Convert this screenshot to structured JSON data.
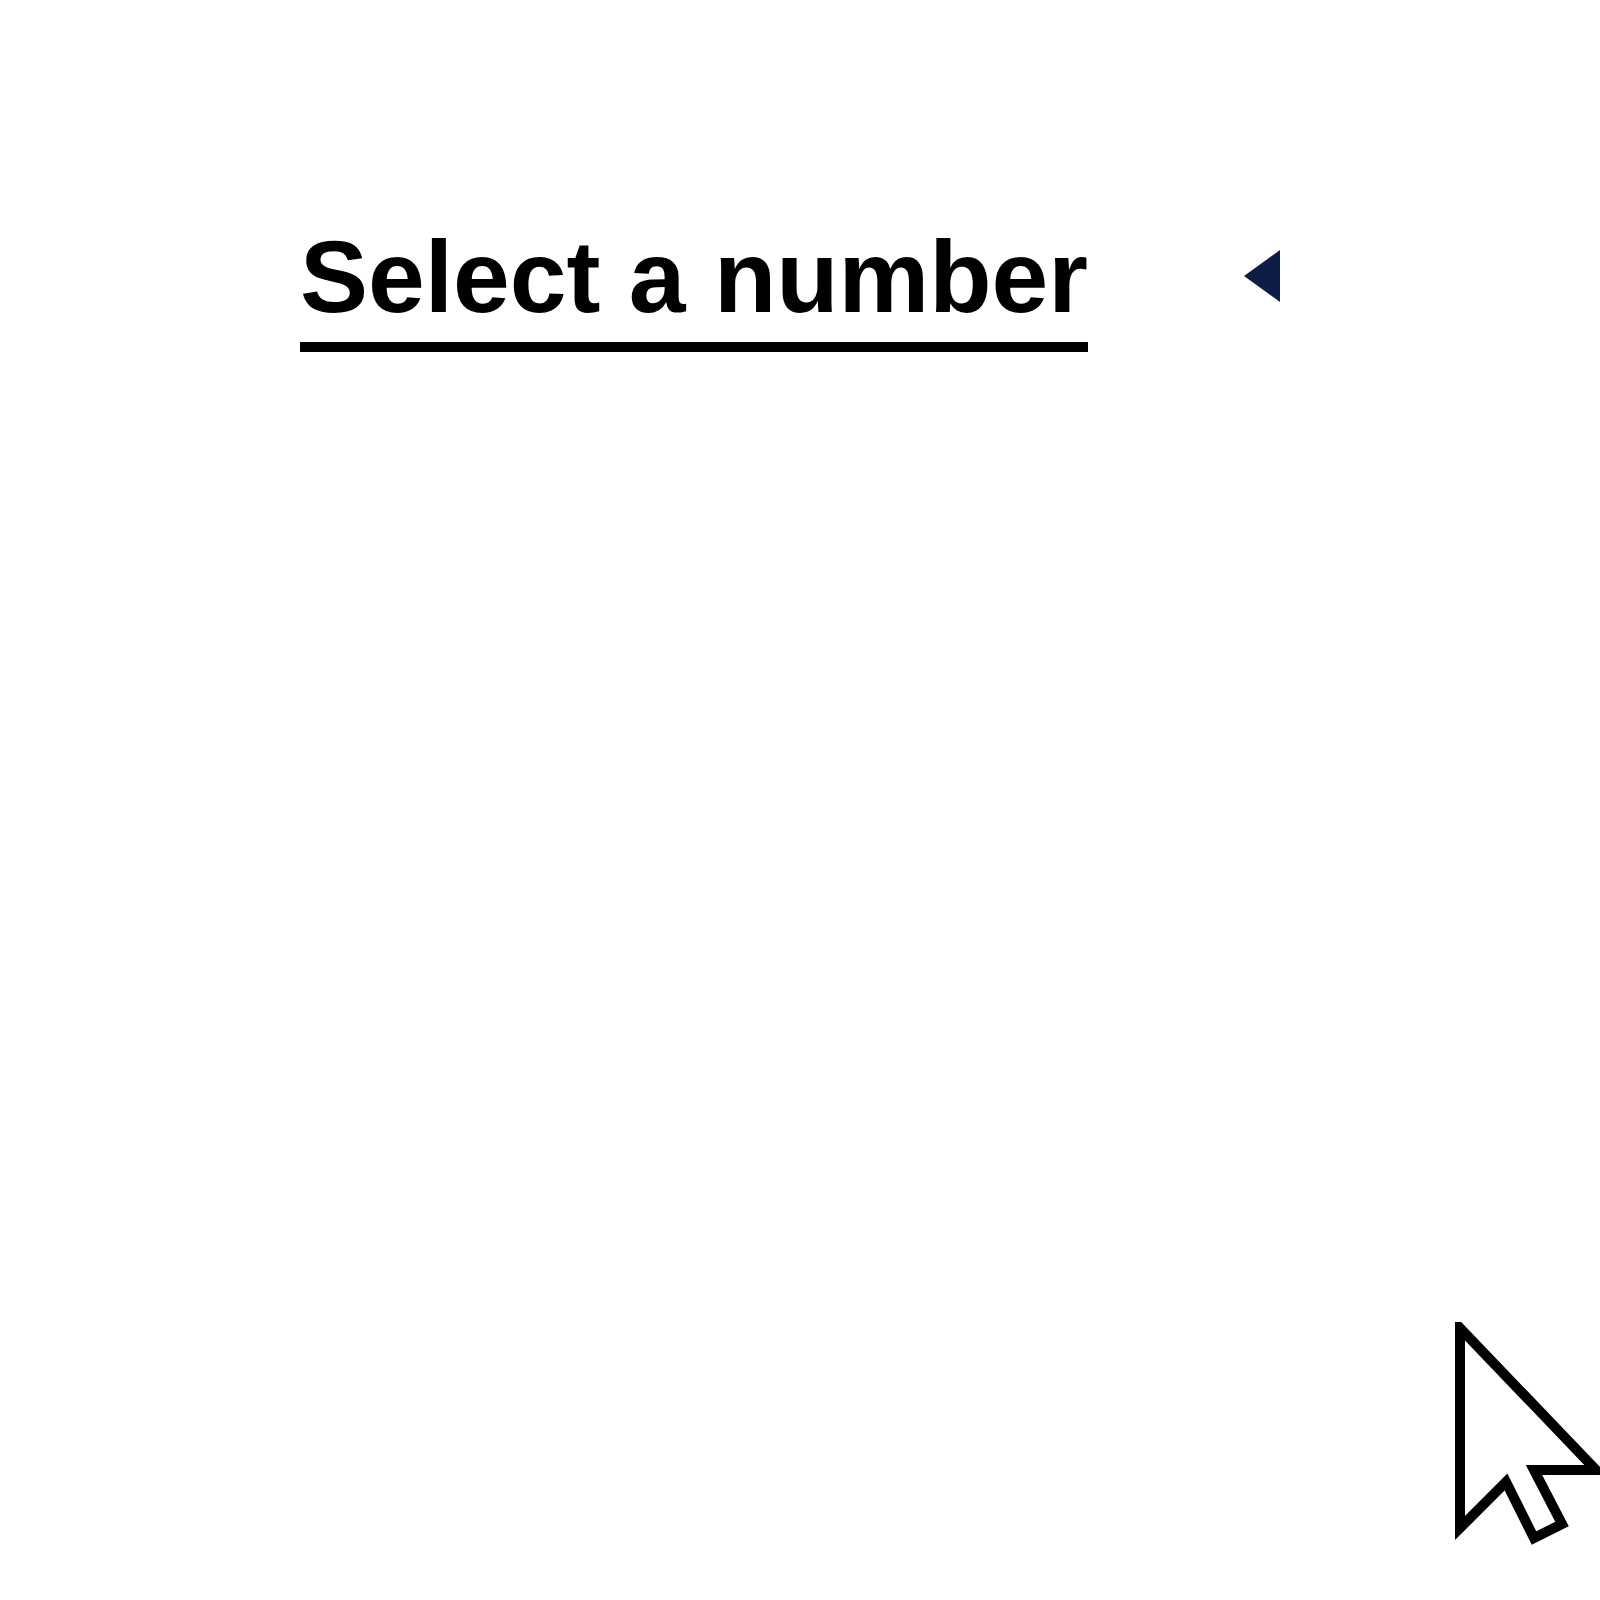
{
  "dropdown": {
    "label": "Select a number",
    "expanded": false
  }
}
